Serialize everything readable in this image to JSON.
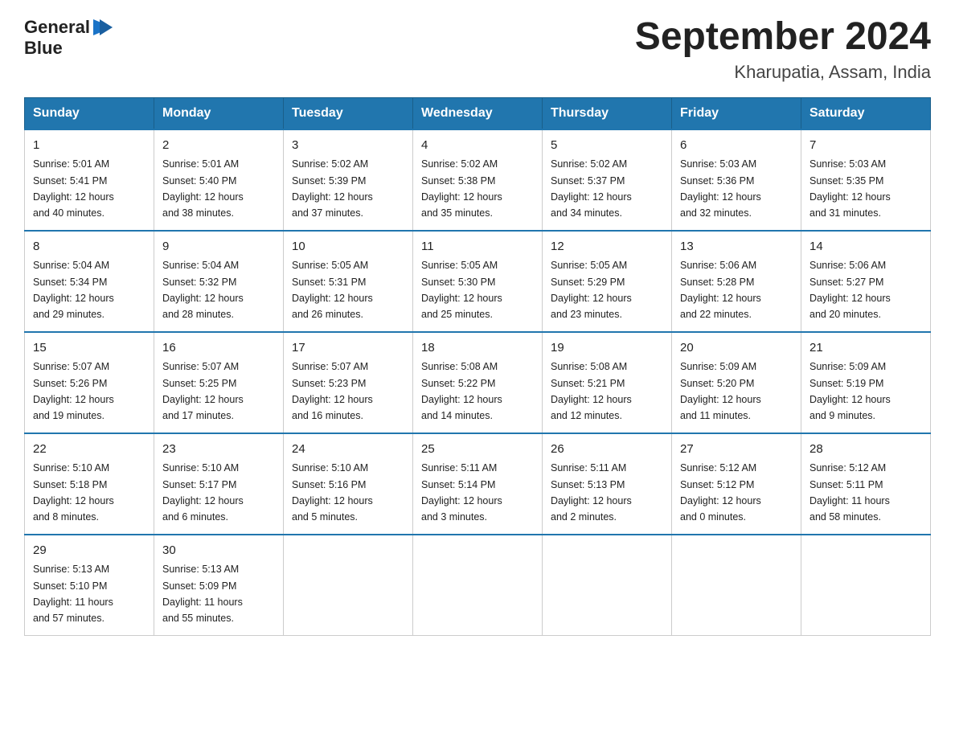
{
  "header": {
    "logo_line1": "General",
    "logo_line2": "Blue",
    "title": "September 2024",
    "subtitle": "Kharupatia, Assam, India"
  },
  "days_of_week": [
    "Sunday",
    "Monday",
    "Tuesday",
    "Wednesday",
    "Thursday",
    "Friday",
    "Saturday"
  ],
  "weeks": [
    [
      {
        "day": "1",
        "sunrise": "5:01 AM",
        "sunset": "5:41 PM",
        "daylight": "12 hours and 40 minutes."
      },
      {
        "day": "2",
        "sunrise": "5:01 AM",
        "sunset": "5:40 PM",
        "daylight": "12 hours and 38 minutes."
      },
      {
        "day": "3",
        "sunrise": "5:02 AM",
        "sunset": "5:39 PM",
        "daylight": "12 hours and 37 minutes."
      },
      {
        "day": "4",
        "sunrise": "5:02 AM",
        "sunset": "5:38 PM",
        "daylight": "12 hours and 35 minutes."
      },
      {
        "day": "5",
        "sunrise": "5:02 AM",
        "sunset": "5:37 PM",
        "daylight": "12 hours and 34 minutes."
      },
      {
        "day": "6",
        "sunrise": "5:03 AM",
        "sunset": "5:36 PM",
        "daylight": "12 hours and 32 minutes."
      },
      {
        "day": "7",
        "sunrise": "5:03 AM",
        "sunset": "5:35 PM",
        "daylight": "12 hours and 31 minutes."
      }
    ],
    [
      {
        "day": "8",
        "sunrise": "5:04 AM",
        "sunset": "5:34 PM",
        "daylight": "12 hours and 29 minutes."
      },
      {
        "day": "9",
        "sunrise": "5:04 AM",
        "sunset": "5:32 PM",
        "daylight": "12 hours and 28 minutes."
      },
      {
        "day": "10",
        "sunrise": "5:05 AM",
        "sunset": "5:31 PM",
        "daylight": "12 hours and 26 minutes."
      },
      {
        "day": "11",
        "sunrise": "5:05 AM",
        "sunset": "5:30 PM",
        "daylight": "12 hours and 25 minutes."
      },
      {
        "day": "12",
        "sunrise": "5:05 AM",
        "sunset": "5:29 PM",
        "daylight": "12 hours and 23 minutes."
      },
      {
        "day": "13",
        "sunrise": "5:06 AM",
        "sunset": "5:28 PM",
        "daylight": "12 hours and 22 minutes."
      },
      {
        "day": "14",
        "sunrise": "5:06 AM",
        "sunset": "5:27 PM",
        "daylight": "12 hours and 20 minutes."
      }
    ],
    [
      {
        "day": "15",
        "sunrise": "5:07 AM",
        "sunset": "5:26 PM",
        "daylight": "12 hours and 19 minutes."
      },
      {
        "day": "16",
        "sunrise": "5:07 AM",
        "sunset": "5:25 PM",
        "daylight": "12 hours and 17 minutes."
      },
      {
        "day": "17",
        "sunrise": "5:07 AM",
        "sunset": "5:23 PM",
        "daylight": "12 hours and 16 minutes."
      },
      {
        "day": "18",
        "sunrise": "5:08 AM",
        "sunset": "5:22 PM",
        "daylight": "12 hours and 14 minutes."
      },
      {
        "day": "19",
        "sunrise": "5:08 AM",
        "sunset": "5:21 PM",
        "daylight": "12 hours and 12 minutes."
      },
      {
        "day": "20",
        "sunrise": "5:09 AM",
        "sunset": "5:20 PM",
        "daylight": "12 hours and 11 minutes."
      },
      {
        "day": "21",
        "sunrise": "5:09 AM",
        "sunset": "5:19 PM",
        "daylight": "12 hours and 9 minutes."
      }
    ],
    [
      {
        "day": "22",
        "sunrise": "5:10 AM",
        "sunset": "5:18 PM",
        "daylight": "12 hours and 8 minutes."
      },
      {
        "day": "23",
        "sunrise": "5:10 AM",
        "sunset": "5:17 PM",
        "daylight": "12 hours and 6 minutes."
      },
      {
        "day": "24",
        "sunrise": "5:10 AM",
        "sunset": "5:16 PM",
        "daylight": "12 hours and 5 minutes."
      },
      {
        "day": "25",
        "sunrise": "5:11 AM",
        "sunset": "5:14 PM",
        "daylight": "12 hours and 3 minutes."
      },
      {
        "day": "26",
        "sunrise": "5:11 AM",
        "sunset": "5:13 PM",
        "daylight": "12 hours and 2 minutes."
      },
      {
        "day": "27",
        "sunrise": "5:12 AM",
        "sunset": "5:12 PM",
        "daylight": "12 hours and 0 minutes."
      },
      {
        "day": "28",
        "sunrise": "5:12 AM",
        "sunset": "5:11 PM",
        "daylight": "11 hours and 58 minutes."
      }
    ],
    [
      {
        "day": "29",
        "sunrise": "5:13 AM",
        "sunset": "5:10 PM",
        "daylight": "11 hours and 57 minutes."
      },
      {
        "day": "30",
        "sunrise": "5:13 AM",
        "sunset": "5:09 PM",
        "daylight": "11 hours and 55 minutes."
      },
      null,
      null,
      null,
      null,
      null
    ]
  ],
  "labels": {
    "sunrise": "Sunrise:",
    "sunset": "Sunset:",
    "daylight": "Daylight:"
  }
}
